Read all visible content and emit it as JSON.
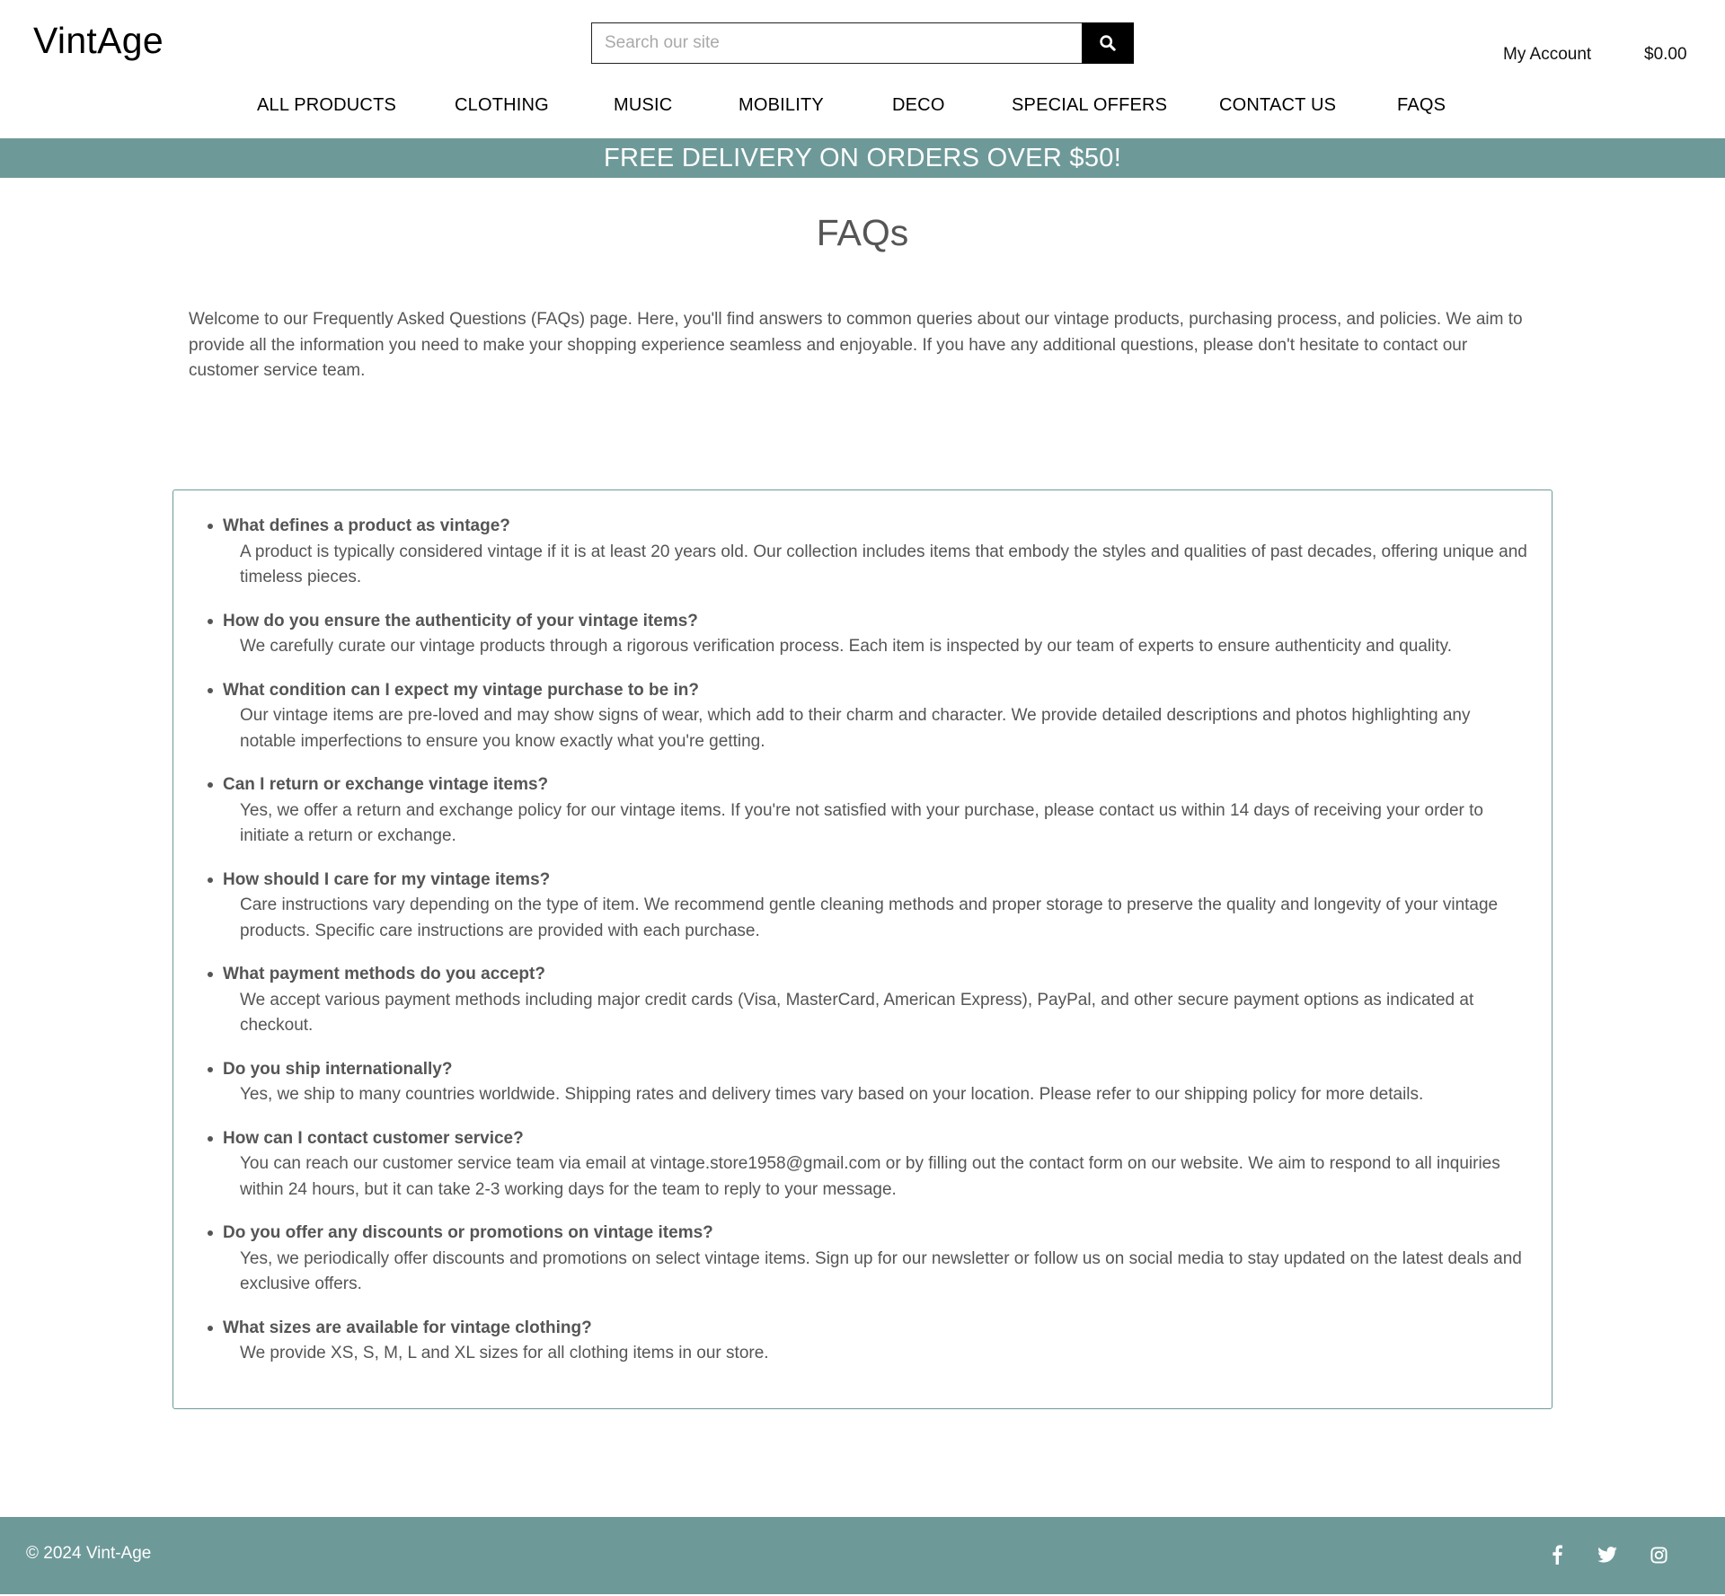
{
  "header": {
    "logo": "VintAge",
    "search_placeholder": "Search our site",
    "search_icon": "search-icon",
    "account_label": "My Account",
    "cart_total": "$0.00"
  },
  "nav": {
    "items": [
      {
        "label": "ALL PRODUCTS"
      },
      {
        "label": "CLOTHING"
      },
      {
        "label": "MUSIC"
      },
      {
        "label": "MOBILITY"
      },
      {
        "label": "DECO"
      },
      {
        "label": "SPECIAL OFFERS"
      },
      {
        "label": "CONTACT US"
      },
      {
        "label": "FAQS"
      }
    ]
  },
  "banner": {
    "text": "FREE DELIVERY ON ORDERS OVER $50!"
  },
  "main": {
    "title": "FAQs",
    "intro": "Welcome to our Frequently Asked Questions (FAQs) page. Here, you'll find answers to common queries about our vintage products, purchasing process, and policies. We aim to provide all the information you need to make your shopping experience seamless and enjoyable. If you have any additional questions, please don't hesitate to contact our customer service team.",
    "faqs": [
      {
        "question": "What defines a product as vintage?",
        "answer": "A product is typically considered vintage if it is at least 20 years old. Our collection includes items that embody the styles and qualities of past decades, offering unique and timeless pieces."
      },
      {
        "question": "How do you ensure the authenticity of your vintage items?",
        "answer": "We carefully curate our vintage products through a rigorous verification process. Each item is inspected by our team of experts to ensure authenticity and quality."
      },
      {
        "question": "What condition can I expect my vintage purchase to be in?",
        "answer": "Our vintage items are pre-loved and may show signs of wear, which add to their charm and character. We provide detailed descriptions and photos highlighting any notable imperfections to ensure you know exactly what you're getting."
      },
      {
        "question": "Can I return or exchange vintage items?",
        "answer": "Yes, we offer a return and exchange policy for our vintage items. If you're not satisfied with your purchase, please contact us within 14 days of receiving your order to initiate a return or exchange."
      },
      {
        "question": "How should I care for my vintage items?",
        "answer": "Care instructions vary depending on the type of item. We recommend gentle cleaning methods and proper storage to preserve the quality and longevity of your vintage products. Specific care instructions are provided with each purchase."
      },
      {
        "question": "What payment methods do you accept?",
        "answer": "We accept various payment methods including major credit cards (Visa, MasterCard, American Express), PayPal, and other secure payment options as indicated at checkout."
      },
      {
        "question": "Do you ship internationally?",
        "answer": "Yes, we ship to many countries worldwide. Shipping rates and delivery times vary based on your location. Please refer to our shipping policy for more details."
      },
      {
        "question": "How can I contact customer service?",
        "answer": "You can reach our customer service team via email at vintage.store1958@gmail.com or by filling out the contact form on our website. We aim to respond to all inquiries within 24 hours, but it can take 2-3 working days for the team to reply to your message."
      },
      {
        "question": "Do you offer any discounts or promotions on vintage items?",
        "answer": "Yes, we periodically offer discounts and promotions on select vintage items. Sign up for our newsletter or follow us on social media to stay updated on the latest deals and exclusive offers."
      },
      {
        "question": "What sizes are available for vintage clothing?",
        "answer": "We provide XS, S, M, L and XL sizes for all clothing items in our store."
      }
    ]
  },
  "footer": {
    "copyright": "© 2024 Vint-Age",
    "social_icons": [
      "facebook-icon",
      "twitter-icon",
      "instagram-icon"
    ]
  },
  "colors": {
    "accent": "#6e9999",
    "text_muted": "#555555",
    "search_button": "#000000"
  }
}
